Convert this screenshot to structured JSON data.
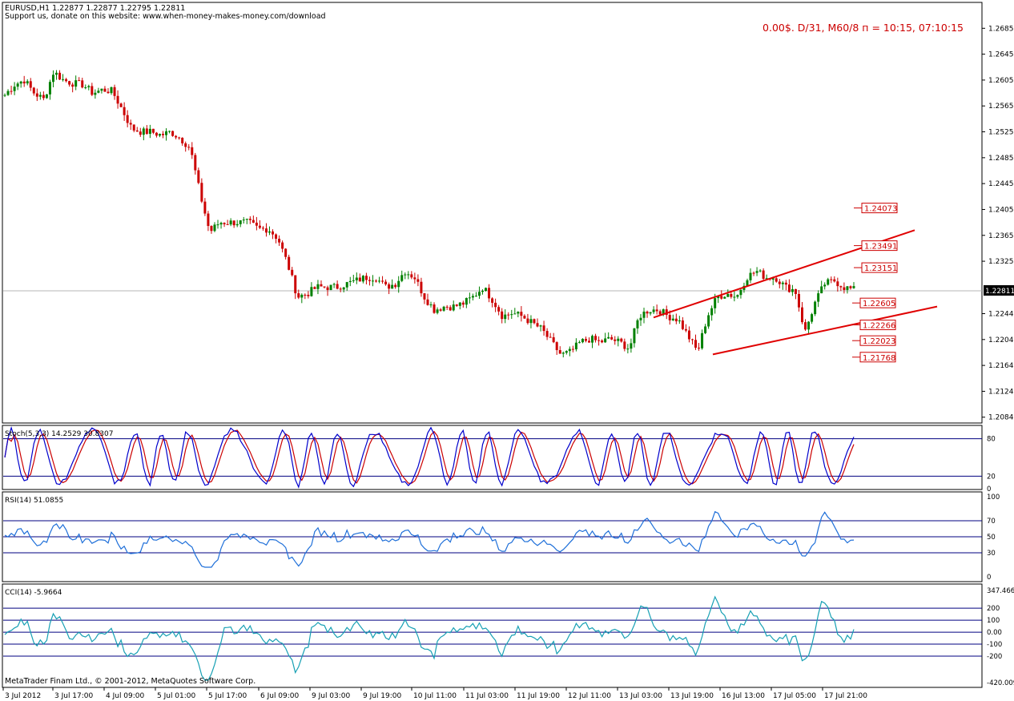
{
  "header": {
    "symbol_line": "EURUSD,H1  1.22877 1.22877 1.22795 1.22811",
    "support_line": "Support us, donate on this website: www.when-money-makes-money.com/download",
    "status_line": "0.00$.   D/31,   M60/8 п = 10:15,  07:10:15"
  },
  "footer": {
    "copyright": "MetaTrader Finam Ltd., © 2001-2012, MetaQuotes Software Corp."
  },
  "colors": {
    "background": "#ffffff",
    "frame": "#000000",
    "bull": "#008000",
    "bear": "#cc0000",
    "trend": "#e00000",
    "level_label": "#cc0000",
    "status": "#cc0000",
    "stoch_main": "#0000cc",
    "stoch_signal": "#cc0000",
    "rsi": "#1e6fd9",
    "cci": "#17a0b4",
    "level_line": "#000080",
    "current_price_line": "#b4b4b4"
  },
  "chart_data": [
    {
      "type": "candlestick",
      "symbol": "EURUSD",
      "timeframe": "H1",
      "ylim": [
        1.2075,
        1.2725
      ],
      "yticks": [
        "1.26850",
        "1.26450",
        "1.26050",
        "1.25650",
        "1.25250",
        "1.24850",
        "1.24450",
        "1.24050",
        "1.23650",
        "1.23250",
        "1.22440",
        "1.22040",
        "1.21640",
        "1.21240",
        "1.20840"
      ],
      "current_price": "1.22811",
      "xticks": [
        "3 Jul 2012",
        "3 Jul 17:00",
        "4 Jul 09:00",
        "5 Jul 01:00",
        "5 Jul 17:00",
        "6 Jul 09:00",
        "9 Jul 03:00",
        "9 Jul 19:00",
        "10 Jul 11:00",
        "11 Jul 03:00",
        "11 Jul 19:00",
        "12 Jul 11:00",
        "13 Jul 03:00",
        "13 Jul 19:00",
        "16 Jul 13:00",
        "17 Jul 05:00",
        "17 Jul 21:00"
      ],
      "price_path": [
        1.2582,
        1.2598,
        1.2605,
        1.2585,
        1.2575,
        1.2618,
        1.2605,
        1.26,
        1.2598,
        1.2585,
        1.259,
        1.2588,
        1.256,
        1.253,
        1.2525,
        1.2525,
        1.252,
        1.2525,
        1.2515,
        1.25,
        1.243,
        1.237,
        1.2385,
        1.2385,
        1.2385,
        1.2385,
        1.2375,
        1.2375,
        1.236,
        1.232,
        1.227,
        1.2275,
        1.2285,
        1.2285,
        1.2285,
        1.229,
        1.2295,
        1.23,
        1.23,
        1.2285,
        1.229,
        1.231,
        1.23,
        1.227,
        1.225,
        1.2255,
        1.2255,
        1.226,
        1.227,
        1.2285,
        1.2265,
        1.224,
        1.2245,
        1.224,
        1.223,
        1.222,
        1.22,
        1.218,
        1.2185,
        1.22,
        1.2205,
        1.22,
        1.2205,
        1.22,
        1.219,
        1.224,
        1.225,
        1.225,
        1.224,
        1.2235,
        1.221,
        1.2185,
        1.224,
        1.227,
        1.2275,
        1.227,
        1.23,
        1.231,
        1.23,
        1.23,
        1.2285,
        1.228,
        1.2215,
        1.226,
        1.229,
        1.2295,
        1.2285,
        1.2281
      ],
      "level_labels": [
        "1.24073",
        "1.23491",
        "1.23151",
        "1.22605",
        "1.22266",
        "1.22023",
        "1.21768"
      ],
      "trendlines": [
        {
          "from": [
            "13 Jul 03:00",
            1.2238
          ],
          "to": [
            "17 Jul 21:00+",
            1.2373
          ]
        },
        {
          "from": [
            "16 Jul 13:00-",
            1.2181
          ],
          "to": [
            "17 Jul 21:00+",
            1.2255
          ]
        }
      ]
    },
    {
      "type": "line",
      "title": "Stoch(5,3,3) 14.2529 30.8307",
      "ylim": [
        0,
        100
      ],
      "levels": [
        "80",
        "20",
        "0"
      ],
      "series": [
        {
          "name": "main"
        },
        {
          "name": "signal"
        }
      ]
    },
    {
      "type": "line",
      "title": "RSI(14) 51.0855",
      "ylim": [
        0,
        100
      ],
      "tick_labels": [
        "100",
        "70",
        "50",
        "30",
        "0"
      ]
    },
    {
      "type": "line",
      "title": "CCI(14) -5.9664",
      "ylim": [
        -420.009,
        347.466
      ],
      "tick_labels": [
        "347.466",
        "200",
        "100",
        "0.00",
        "-100",
        "-200",
        "-420.009"
      ]
    }
  ]
}
